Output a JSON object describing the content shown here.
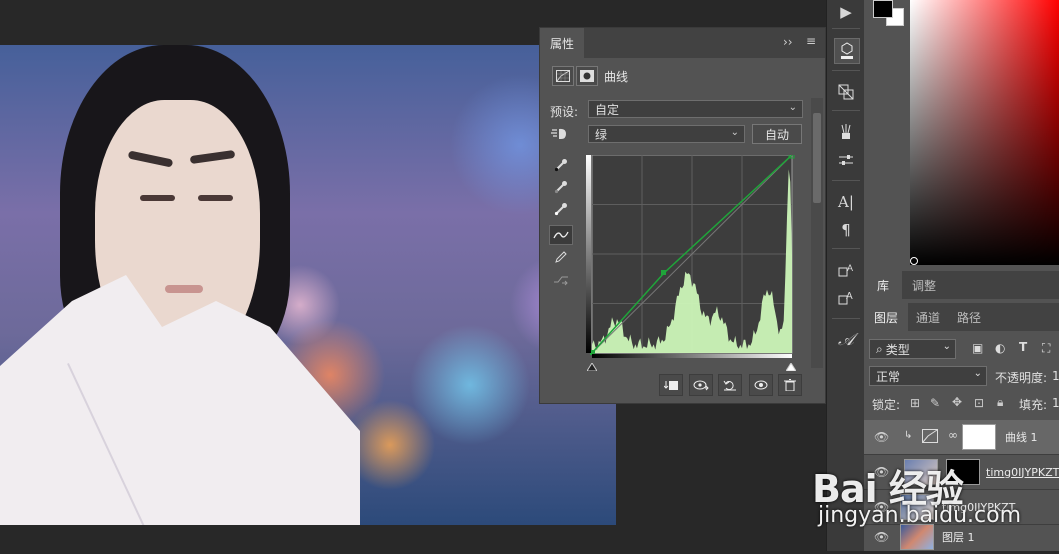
{
  "properties": {
    "tab_label": "属性",
    "adjustment_title": "曲线",
    "expand_glyph": "››",
    "menu_glyph": "≡",
    "preset_label": "预设:",
    "preset_value": "自定",
    "channel_value": "绿",
    "auto_button": "自动",
    "icons": [
      "curves-icon",
      "mask-icon",
      "hand-adjust-icon",
      "eyedropper-black-icon",
      "eyedropper-gray-icon",
      "eyedropper-white-icon",
      "curve-point-icon",
      "pencil-icon",
      "smooth-icon",
      "clip-to-layer-icon",
      "view-previous-icon",
      "reset-icon",
      "visibility-icon",
      "trash-icon"
    ],
    "histogram_color": "#ccf5b8",
    "curve_color": "#1fa53a"
  },
  "right_panel": {
    "tabs_top": [
      "库",
      "调整"
    ],
    "tabs_layers": [
      "图层",
      "通道",
      "路径"
    ],
    "filter_label": "类型",
    "blend_mode": "正常",
    "opacity_label": "不透明度:",
    "opacity_value": "1",
    "lock_label": "锁定:",
    "fill_label": "填充:",
    "fill_value": "1",
    "layers": [
      {
        "name": "曲线 1",
        "type": "adjustment"
      },
      {
        "name": "timg0IJYPKZT",
        "type": "masked"
      },
      {
        "name": "timg0IJYPKZT",
        "type": "image"
      },
      {
        "name": "图层 1",
        "type": "image"
      }
    ]
  },
  "toolbar_right_icons": [
    "play-icon",
    "3d-icon",
    "clone-source-icon",
    "brush-settings-icon",
    "adjustments-icon",
    "character-icon",
    "paragraph-icon",
    "character-style-icon",
    "paragraph-style-icon",
    "glyph-icon"
  ],
  "watermark": {
    "brand": "Bai 经验",
    "url": "jingyan.baidu.com"
  }
}
